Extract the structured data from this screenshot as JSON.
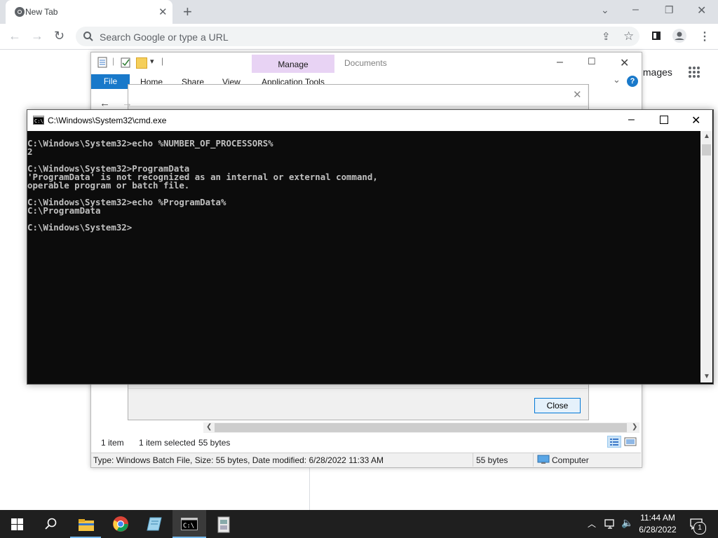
{
  "chrome": {
    "tab_title": "New Tab",
    "omnibox_placeholder": "Search Google or type a URL",
    "images_link": "Images"
  },
  "explorer": {
    "manage_label": "Manage",
    "window_title": "Documents",
    "ribbon_tabs": [
      "File",
      "Home",
      "Share",
      "View",
      "Application Tools"
    ],
    "status_items": "1 item",
    "status_selected": "1 item selected",
    "status_size": "55 bytes",
    "detail_text": "Type: Windows Batch File, Size: 55 bytes, Date modified: 6/28/2022 11:33 AM",
    "detail_size": "55 bytes",
    "detail_location": "Computer"
  },
  "dialog": {
    "close_label": "Close"
  },
  "cmd": {
    "title": "C:\\Windows\\System32\\cmd.exe",
    "output": "C:\\Windows\\System32>echo %NUMBER_OF_PROCESSORS%\n2\n\nC:\\Windows\\System32>ProgramData\n'ProgramData' is not recognized as an internal or external command,\noperable program or batch file.\n\nC:\\Windows\\System32>echo %ProgramData%\nC:\\ProgramData\n\nC:\\Windows\\System32>"
  },
  "taskbar": {
    "time": "11:44 AM",
    "date": "6/28/2022",
    "notification_count": "1"
  },
  "colors": {
    "chrome_tabbar": "#dee1e6",
    "explorer_file_tab": "#1979ca",
    "manage_tab": "#e8d3f4",
    "cmd_background": "#0c0c0c",
    "taskbar": "#1f1f1f"
  }
}
